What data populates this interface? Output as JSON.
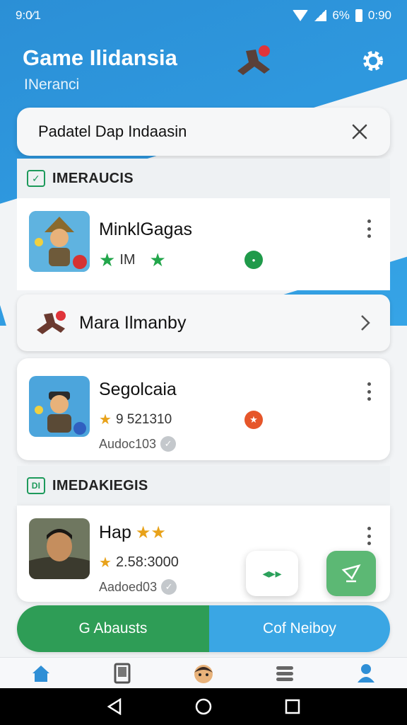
{
  "status_bar": {
    "time": "9:0⁄1",
    "battery_pct": "6%",
    "clock_right": "0:90"
  },
  "header": {
    "title": "Game Ilidansia",
    "subtitle": "INeranci"
  },
  "search": {
    "value": "Padatel Dap Indaasin"
  },
  "sections": [
    {
      "title": "IMERAUCIS",
      "icon": "check-square-icon"
    },
    {
      "title": "IMEDAKIEGIS",
      "icon": "bracket-square-icon"
    }
  ],
  "items": [
    {
      "title": "MinklGagas",
      "meta": "IM",
      "badge_color": "#1f9a4a"
    },
    {
      "title": "Segolcaia",
      "meta": "9 521310",
      "sub": "Audoc103",
      "badge_color": "#e6562a"
    },
    {
      "title": "Hap",
      "meta": "2.58:3000",
      "sub": "Aadoed03"
    }
  ],
  "nav_row": {
    "label": "Mara Ilmanby"
  },
  "tabs": {
    "left": "G Abausts",
    "right": "Cof Neiboy"
  },
  "bottom_nav": [
    "home-icon",
    "book-icon",
    "avatar-icon",
    "list-icon",
    "profile-icon"
  ],
  "colors": {
    "primary_blue": "#2f9ae0",
    "green": "#2e9d56",
    "accent_orange": "#e8a21a"
  }
}
